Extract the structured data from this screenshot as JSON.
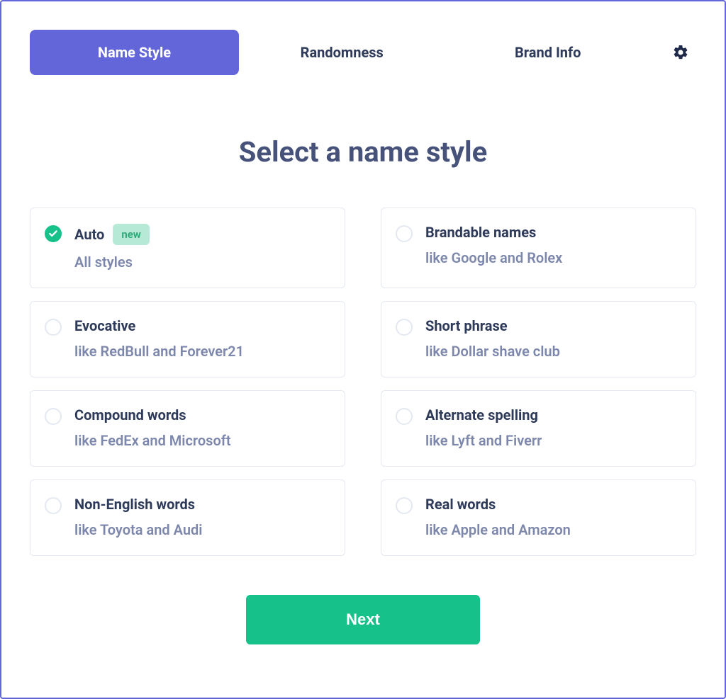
{
  "tabs": {
    "name_style": "Name Style",
    "randomness": "Randomness",
    "brand_info": "Brand Info"
  },
  "heading": "Select a name style",
  "options": {
    "auto": {
      "title": "Auto",
      "desc": "All styles",
      "badge": "new"
    },
    "brandable": {
      "title": "Brandable names",
      "desc": "like Google and Rolex"
    },
    "evocative": {
      "title": "Evocative",
      "desc": "like RedBull and Forever21"
    },
    "short_phrase": {
      "title": "Short phrase",
      "desc": "like Dollar shave club"
    },
    "compound": {
      "title": "Compound words",
      "desc": "like FedEx and Microsoft"
    },
    "alternate": {
      "title": "Alternate spelling",
      "desc": "like Lyft and Fiverr"
    },
    "non_english": {
      "title": "Non-English words",
      "desc": "like Toyota and Audi"
    },
    "real_words": {
      "title": "Real words",
      "desc": "like Apple and Amazon"
    }
  },
  "next_button": "Next"
}
